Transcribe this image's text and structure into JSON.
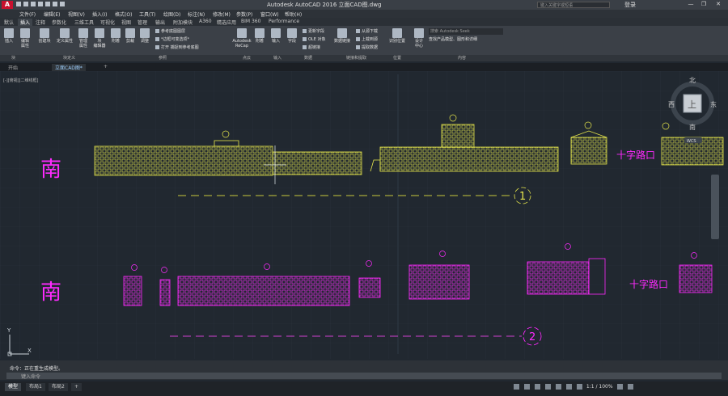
{
  "window": {
    "title": "Autodesk AutoCAD 2016    立面CAD图.dwg",
    "search_placeholder": "键入关键字或短语",
    "user": "登录",
    "minimize": "—",
    "restore": "❐",
    "close": "✕"
  },
  "menubar": [
    "文件(F)",
    "编辑(E)",
    "视图(V)",
    "插入(I)",
    "格式(O)",
    "工具(T)",
    "绘图(D)",
    "标注(N)",
    "修改(M)",
    "参数(P)",
    "窗口(W)",
    "帮助(H)"
  ],
  "ribbon_tabs": [
    "默认",
    "插入",
    "注释",
    "参数化",
    "三维工具",
    "可视化",
    "视图",
    "管理",
    "输出",
    "附加模块",
    "A360",
    "精选应用",
    "BIM 360",
    "Performance"
  ],
  "ribbon": {
    "buttons": [
      {
        "label": "插入"
      },
      {
        "label": "编辑\n属性"
      },
      {
        "label": "创建块"
      },
      {
        "label": "定义属性"
      },
      {
        "label": "管理\n属性"
      },
      {
        "label": "块\n编辑器"
      },
      {
        "label": "附着"
      },
      {
        "label": "剪裁"
      },
      {
        "label": "调整"
      },
      {
        "label": "Autodesk\nReCap"
      },
      {
        "label": "附着"
      },
      {
        "label": "输入"
      },
      {
        "label": "字段"
      },
      {
        "label": "数据链接"
      },
      {
        "label": "设计\n中心"
      },
      {
        "label": "识别位置"
      }
    ],
    "small": {
      "ref_underlay": "参考底图图层",
      "frames": "*边框可变选项*",
      "snap": "捕捉到参考底图",
      "open": "打开",
      "update_fields": "更新字段",
      "ole": "OLE 对象",
      "hyperlink": "超链接",
      "download_from": "从源下载",
      "upload_to": "上载到源",
      "extract": "提取数据",
      "seek_placeholder": "搜索 Autodesk Seek",
      "seek_desc": "查找产品模型、图形和详细"
    },
    "panels": [
      "块",
      "块定义",
      "参照",
      "点云",
      "输入",
      "数据",
      "链接和提取",
      "位置",
      "内容"
    ]
  },
  "doc_tabs": [
    "开始",
    "立面CAD图*",
    "+"
  ],
  "viewport_label": "[-][俯视][二维线框]",
  "drawing": {
    "south_label": "南",
    "intersection": "十字路口",
    "markers": [
      "1",
      "2"
    ],
    "compass": {
      "north": "北",
      "south": "南",
      "east": "东",
      "west": "西",
      "top": "上",
      "wcs": "WCS"
    },
    "axis": {
      "x": "X",
      "y": "Y"
    },
    "colors": {
      "yellow": "#e6e64c",
      "magenta": "#ff2aff",
      "grid": "#262d35"
    }
  },
  "command": {
    "history": "命令：正在重生成模型。",
    "prompt": "键入命令"
  },
  "status": {
    "tabs": [
      "模型",
      "布局1",
      "布局2",
      "+"
    ],
    "scale": "1:1 / 100%"
  }
}
